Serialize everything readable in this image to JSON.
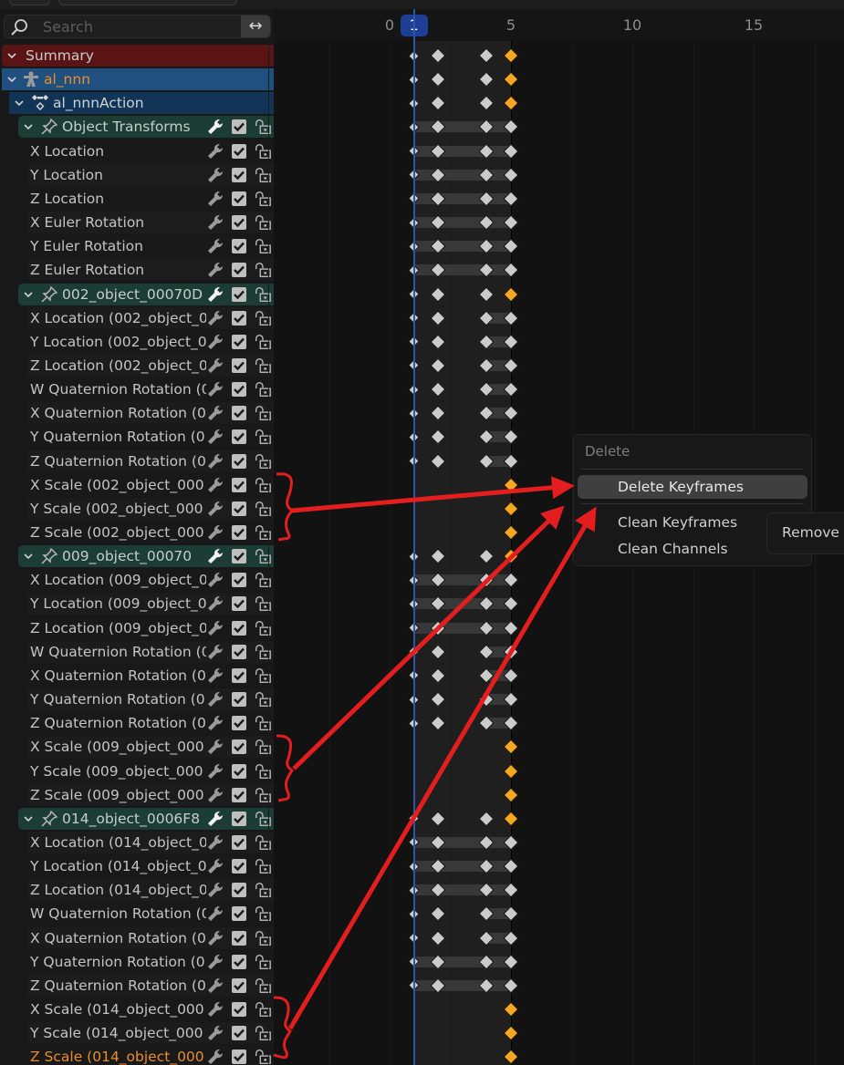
{
  "search": {
    "placeholder": "Search",
    "swap_icon": "↔"
  },
  "ruler": {
    "ticks": [
      {
        "label": "0",
        "frame": 0
      },
      {
        "label": "5",
        "frame": 5
      },
      {
        "label": "10",
        "frame": 10
      },
      {
        "label": "15",
        "frame": 15
      }
    ],
    "current_frame": "1"
  },
  "channels": [
    {
      "type": "summary",
      "label": "Summary"
    },
    {
      "type": "object",
      "label": "al_nnn"
    },
    {
      "type": "action",
      "label": "al_nnnAction"
    },
    {
      "type": "group",
      "label": "Object Transforms"
    },
    {
      "type": "chan",
      "label": "X Location"
    },
    {
      "type": "chan",
      "label": "Y Location"
    },
    {
      "type": "chan",
      "label": "Z Location"
    },
    {
      "type": "chan",
      "label": "X Euler Rotation"
    },
    {
      "type": "chan",
      "label": "Y Euler Rotation"
    },
    {
      "type": "chan",
      "label": "Z Euler Rotation"
    },
    {
      "type": "group",
      "label": "002_object_00070D"
    },
    {
      "type": "chan",
      "label": "X Location (002_object_0"
    },
    {
      "type": "chan",
      "label": "Y Location (002_object_0"
    },
    {
      "type": "chan",
      "label": "Z Location (002_object_0"
    },
    {
      "type": "chan",
      "label": "W Quaternion Rotation (0"
    },
    {
      "type": "chan",
      "label": "X Quaternion Rotation (0"
    },
    {
      "type": "chan",
      "label": "Y Quaternion Rotation (0"
    },
    {
      "type": "chan",
      "label": "Z Quaternion Rotation (0"
    },
    {
      "type": "chan",
      "label": "X Scale (002_object_000"
    },
    {
      "type": "chan",
      "label": "Y Scale (002_object_000"
    },
    {
      "type": "chan",
      "label": "Z Scale (002_object_000"
    },
    {
      "type": "group",
      "label": "009_object_00070"
    },
    {
      "type": "chan",
      "label": "X Location (009_object_0"
    },
    {
      "type": "chan",
      "label": "Y Location (009_object_0"
    },
    {
      "type": "chan",
      "label": "Z Location (009_object_0"
    },
    {
      "type": "chan",
      "label": "W Quaternion Rotation (0"
    },
    {
      "type": "chan",
      "label": "X Quaternion Rotation (0"
    },
    {
      "type": "chan",
      "label": "Y Quaternion Rotation (0"
    },
    {
      "type": "chan",
      "label": "Z Quaternion Rotation (0"
    },
    {
      "type": "chan",
      "label": "X Scale (009_object_000"
    },
    {
      "type": "chan",
      "label": "Y Scale (009_object_000"
    },
    {
      "type": "chan",
      "label": "Z Scale (009_object_000"
    },
    {
      "type": "group",
      "label": "014_object_0006F8"
    },
    {
      "type": "chan",
      "label": "X Location (014_object_0"
    },
    {
      "type": "chan",
      "label": "Y Location (014_object_0"
    },
    {
      "type": "chan",
      "label": "Z Location (014_object_0"
    },
    {
      "type": "chan",
      "label": "W Quaternion Rotation (0"
    },
    {
      "type": "chan",
      "label": "X Quaternion Rotation (0"
    },
    {
      "type": "chan",
      "label": "Y Quaternion Rotation (0"
    },
    {
      "type": "chan",
      "label": "Z Quaternion Rotation (0"
    },
    {
      "type": "chan",
      "label": "X Scale (014_object_000"
    },
    {
      "type": "chan",
      "label": "Y Scale (014_object_000"
    },
    {
      "type": "chan",
      "label": "Z Scale (014_object_000",
      "active": true
    }
  ],
  "keyframes": {
    "rows": [
      {
        "keys": [
          1,
          2,
          4,
          5
        ],
        "selected": [
          5
        ],
        "hold": null
      },
      {
        "keys": [
          1,
          2,
          4,
          5
        ],
        "selected": [
          5
        ],
        "hold": null
      },
      {
        "keys": [
          1,
          2,
          4,
          5
        ],
        "selected": [
          5
        ],
        "hold": null
      },
      {
        "keys": [
          1,
          2,
          4,
          5
        ],
        "selected": [],
        "hold": [
          1,
          5
        ]
      },
      {
        "keys": [
          1,
          2,
          4,
          5
        ],
        "selected": [],
        "hold": [
          1,
          5
        ]
      },
      {
        "keys": [
          1,
          2,
          4,
          5
        ],
        "selected": [],
        "hold": [
          1,
          5
        ]
      },
      {
        "keys": [
          1,
          2,
          4,
          5
        ],
        "selected": [],
        "hold": [
          1,
          5
        ]
      },
      {
        "keys": [
          1,
          2,
          4,
          5
        ],
        "selected": [],
        "hold": [
          1,
          5
        ]
      },
      {
        "keys": [
          1,
          2,
          4,
          5
        ],
        "selected": [],
        "hold": [
          1,
          5
        ]
      },
      {
        "keys": [
          1,
          2,
          4,
          5
        ],
        "selected": [],
        "hold": [
          1,
          5
        ]
      },
      {
        "keys": [
          1,
          2,
          4,
          5
        ],
        "selected": [
          5
        ],
        "hold": null
      },
      {
        "keys": [
          1,
          2,
          4,
          5
        ],
        "selected": [],
        "hold": [
          4,
          5
        ]
      },
      {
        "keys": [
          1,
          2,
          4,
          5
        ],
        "selected": [],
        "hold": [
          4,
          5
        ]
      },
      {
        "keys": [
          1,
          2,
          4,
          5
        ],
        "selected": [],
        "hold": [
          4,
          5
        ]
      },
      {
        "keys": [
          1,
          2,
          4,
          5
        ],
        "selected": [],
        "hold": [
          4,
          5
        ]
      },
      {
        "keys": [
          1,
          2,
          4,
          5
        ],
        "selected": [],
        "hold": [
          4,
          5
        ]
      },
      {
        "keys": [
          1,
          2,
          4,
          5
        ],
        "selected": [],
        "hold": [
          4,
          5
        ]
      },
      {
        "keys": [
          1,
          2,
          4,
          5
        ],
        "selected": [],
        "hold": [
          4,
          5
        ]
      },
      {
        "keys": [
          5
        ],
        "selected": [
          5
        ],
        "hold": null
      },
      {
        "keys": [
          5
        ],
        "selected": [
          5
        ],
        "hold": null
      },
      {
        "keys": [
          5
        ],
        "selected": [
          5
        ],
        "hold": null
      },
      {
        "keys": [
          1,
          2,
          4,
          5
        ],
        "selected": [
          5
        ],
        "hold": null
      },
      {
        "keys": [
          1,
          2,
          4,
          5
        ],
        "selected": [],
        "hold": [
          1,
          5
        ]
      },
      {
        "keys": [
          1,
          2,
          4,
          5
        ],
        "selected": [],
        "hold": [
          1,
          5
        ]
      },
      {
        "keys": [
          1,
          2,
          4,
          5
        ],
        "selected": [],
        "hold": [
          1,
          5
        ]
      },
      {
        "keys": [
          1,
          2,
          4,
          5
        ],
        "selected": [],
        "hold": [
          4,
          5
        ]
      },
      {
        "keys": [
          1,
          2,
          4,
          5
        ],
        "selected": [],
        "hold": [
          4,
          5
        ]
      },
      {
        "keys": [
          1,
          2,
          4,
          5
        ],
        "selected": [],
        "hold": [
          4,
          5
        ]
      },
      {
        "keys": [
          1,
          2,
          4,
          5
        ],
        "selected": [],
        "hold": [
          4,
          5
        ]
      },
      {
        "keys": [
          5
        ],
        "selected": [
          5
        ],
        "hold": null
      },
      {
        "keys": [
          5
        ],
        "selected": [
          5
        ],
        "hold": null
      },
      {
        "keys": [
          5
        ],
        "selected": [
          5
        ],
        "hold": null
      },
      {
        "keys": [
          1,
          2,
          4,
          5
        ],
        "selected": [
          5
        ],
        "hold": null
      },
      {
        "keys": [
          1,
          2,
          4,
          5
        ],
        "selected": [],
        "hold": [
          1,
          5
        ]
      },
      {
        "keys": [
          1,
          2,
          4,
          5
        ],
        "selected": [],
        "hold": [
          1,
          5
        ]
      },
      {
        "keys": [
          1,
          2,
          4,
          5
        ],
        "selected": [],
        "hold": [
          1,
          5
        ]
      },
      {
        "keys": [
          1,
          2,
          4,
          5
        ],
        "selected": [],
        "hold": [
          4,
          5
        ]
      },
      {
        "keys": [
          1,
          2,
          4,
          5
        ],
        "selected": [],
        "hold": [
          4,
          5
        ]
      },
      {
        "keys": [
          1,
          2,
          4,
          5
        ],
        "selected": [],
        "hold": [
          1,
          5
        ]
      },
      {
        "keys": [
          1,
          2,
          4,
          5
        ],
        "selected": [],
        "hold": [
          1,
          5
        ]
      },
      {
        "keys": [
          5
        ],
        "selected": [
          5
        ],
        "hold": null
      },
      {
        "keys": [
          5
        ],
        "selected": [
          5
        ],
        "hold": null
      },
      {
        "keys": [
          5
        ],
        "selected": [
          5
        ],
        "hold": null
      }
    ]
  },
  "context_menu": {
    "title": "Delete",
    "items": [
      {
        "label": "Delete Keyframes",
        "highlighted": true
      },
      {
        "label": "Clean Keyframes",
        "highlighted": false
      },
      {
        "label": "Clean Channels",
        "highlighted": false
      }
    ],
    "submenu_item": "Remove"
  },
  "colors": {
    "selected_key": "#f5a623",
    "unselected_key": "#cbcbcb",
    "playhead": "#1f3f97",
    "annotation": "#e41e1e",
    "summary_bg": "#5a1414",
    "object_bg": "#1f5080",
    "group_bg": "#1c3d33"
  }
}
